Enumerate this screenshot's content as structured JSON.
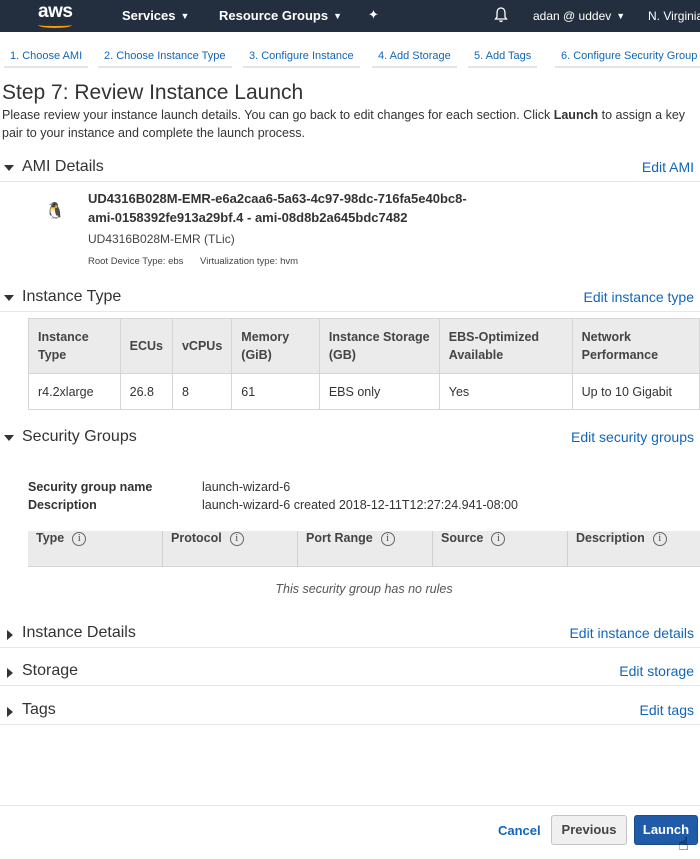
{
  "topnav": {
    "logo": "aws",
    "services": "Services",
    "resource_groups": "Resource Groups",
    "pin_icon": "pin-icon",
    "bell_icon": "bell-icon",
    "user": "adan @ uddev",
    "region": "N. Virginia"
  },
  "steps": [
    {
      "label": "1. Choose AMI"
    },
    {
      "label": "2. Choose Instance Type"
    },
    {
      "label": "3. Configure Instance"
    },
    {
      "label": "4. Add Storage"
    },
    {
      "label": "5. Add Tags"
    },
    {
      "label": "6. Configure Security Group"
    }
  ],
  "page": {
    "title": "Step 7: Review Instance Launch",
    "intro_a": "Please review your instance launch details. You can go back to edit changes for each section. Click ",
    "intro_bold": "Launch",
    "intro_b": " to assign a key pair to your instance and complete the launch process."
  },
  "ami": {
    "section_title": "AMI Details",
    "edit": "Edit AMI",
    "icon": "linux-penguin-icon",
    "name_line1": "UD4316B028M-EMR-e6a2caa6-5a63-4c97-98dc-716fa5e40bc8-",
    "name_line2": "ami-0158392fe913a29bf.4 - ami-08d8b2a645bdc7482",
    "subtitle": "UD4316B028M-EMR (TLic)",
    "root_device": "Root Device Type: ebs",
    "virtualization": "Virtualization type: hvm"
  },
  "instance_type": {
    "section_title": "Instance Type",
    "edit": "Edit instance type",
    "headers": [
      "Instance Type",
      "ECUs",
      "vCPUs",
      "Memory (GiB)",
      "Instance Storage (GB)",
      "EBS-Optimized Available",
      "Network Performance"
    ],
    "row": [
      "r4.2xlarge",
      "26.8",
      "8",
      "61",
      "EBS only",
      "Yes",
      "Up to 10 Gigabit"
    ]
  },
  "security_groups": {
    "section_title": "Security Groups",
    "edit": "Edit security groups",
    "name_label": "Security group name",
    "name_value": "launch-wizard-6",
    "desc_label": "Description",
    "desc_value": "launch-wizard-6 created 2018-12-11T12:27:24.941-08:00",
    "columns": [
      "Type",
      "Protocol",
      "Port Range",
      "Source",
      "Description"
    ],
    "empty": "This security group has no rules"
  },
  "instance_details": {
    "section_title": "Instance Details",
    "edit": "Edit instance details"
  },
  "storage": {
    "section_title": "Storage",
    "edit": "Edit storage"
  },
  "tags": {
    "section_title": "Tags",
    "edit": "Edit tags"
  },
  "footer": {
    "cancel": "Cancel",
    "previous": "Previous",
    "launch": "Launch"
  }
}
